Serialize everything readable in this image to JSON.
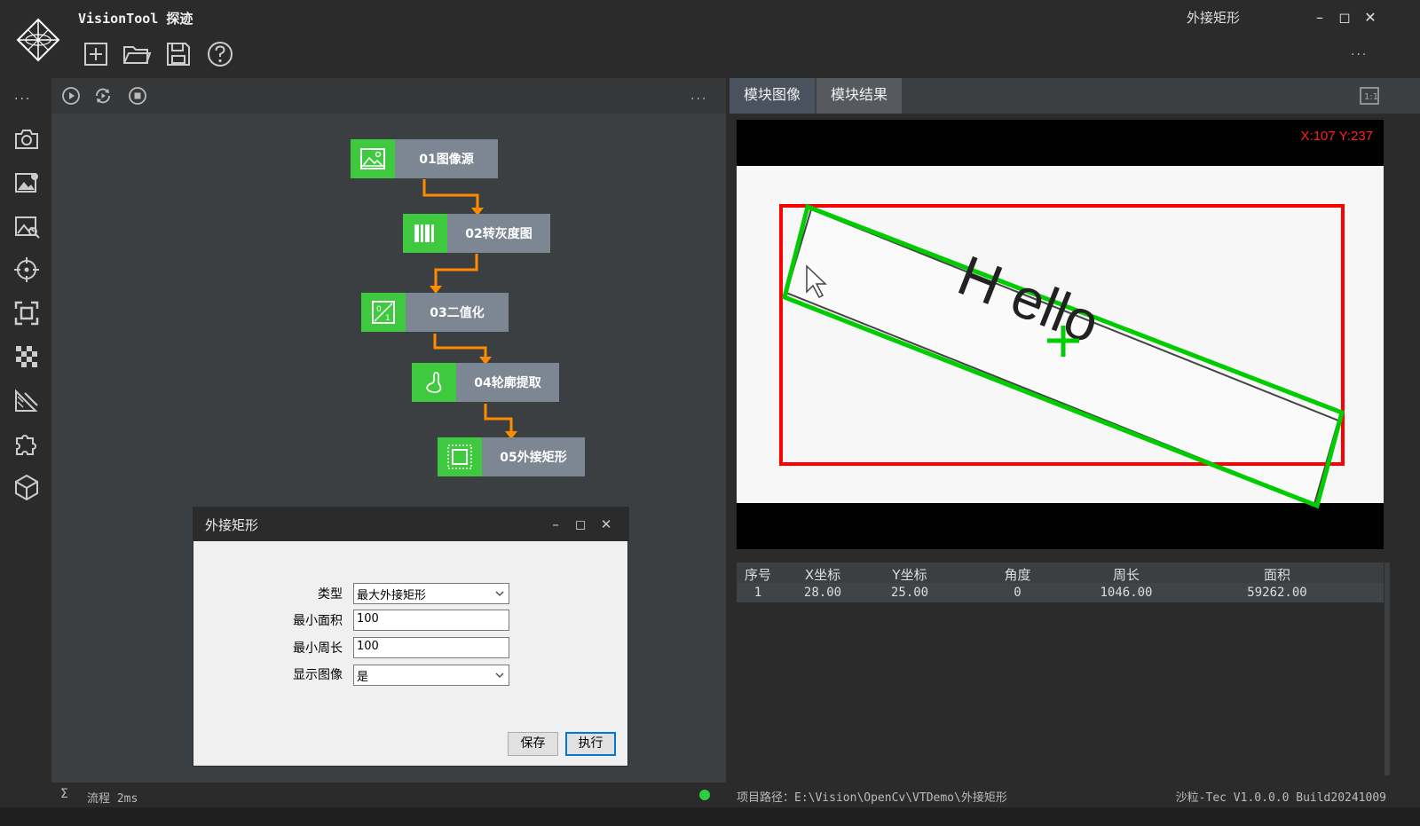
{
  "app": {
    "title": "VisionTool 探迹",
    "window_caption": "外接矩形",
    "toolbar_icons": [
      "new-file-icon",
      "open-folder-icon",
      "save-icon",
      "help-icon"
    ],
    "more": "..."
  },
  "sidebar": {
    "more": "...",
    "icons": [
      "camera-icon",
      "image-settings-icon",
      "image-search-icon",
      "crosshair-icon",
      "focus-frame-icon",
      "checker-icon",
      "measure-icon",
      "puzzle-icon",
      "cube-icon"
    ]
  },
  "flow": {
    "toolbar_icons": [
      "play-icon",
      "loop-icon",
      "stop-icon"
    ],
    "more": "...",
    "nodes": [
      {
        "label": "01图像源",
        "icon": "image-icon"
      },
      {
        "label": "02转灰度图",
        "icon": "grayscale-icon"
      },
      {
        "label": "03二值化",
        "icon": "binary-icon"
      },
      {
        "label": "04轮廓提取",
        "icon": "contour-icon"
      },
      {
        "label": "05外接矩形",
        "icon": "bounding-rect-icon"
      }
    ],
    "connector_color": "#ff8c00",
    "node_accent": "#3ec93e"
  },
  "dialog": {
    "title": "外接矩形",
    "fields": [
      {
        "label": "类型",
        "value": "最大外接矩形",
        "kind": "select"
      },
      {
        "label": "最小面积",
        "value": "100",
        "kind": "input"
      },
      {
        "label": "最小周长",
        "value": "100",
        "kind": "input"
      },
      {
        "label": "显示图像",
        "value": "是",
        "kind": "select"
      }
    ],
    "save_label": "保存",
    "run_label": "执行"
  },
  "status": {
    "sigma": "Σ",
    "flow_time": "流程 2ms",
    "indicator_color": "#2ecc40"
  },
  "right": {
    "tabs": [
      "模块图像",
      "模块结果"
    ],
    "active_tab": "模块图像",
    "coord_readout": "X:107 Y:237",
    "image_text": "H ello",
    "colors": {
      "bounding_rect": "#ff0000",
      "min_rect": "#00cc00"
    },
    "table": {
      "columns": [
        "序号",
        "X坐标",
        "Y坐标",
        "角度",
        "周长",
        "面积"
      ],
      "rows": [
        [
          "1",
          "28.00",
          "25.00",
          "0",
          "1046.00",
          "59262.00"
        ]
      ]
    },
    "project_path": "项目路径：E:\\Vision\\OpenCv\\VTDemo\\外接矩形",
    "version": "沙粒-Tec V1.0.0.0 Build20241009"
  }
}
